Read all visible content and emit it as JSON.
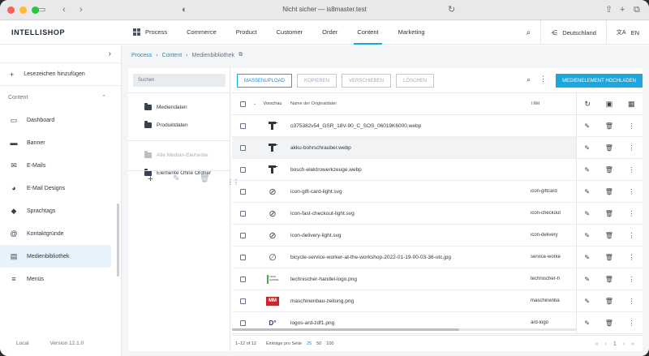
{
  "browser": {
    "url_text": "Nicht sicher — is8master.test"
  },
  "header": {
    "logo": "INTELLISHOP",
    "nav": [
      "Process",
      "Commerce",
      "Product",
      "Customer",
      "Order",
      "Content",
      "Marketing"
    ],
    "active_nav": "Content",
    "country": "Deutschland",
    "language": "EN",
    "accent": "#1aa6de"
  },
  "sidebar": {
    "bookmark": "Lesezeichen hinzufügen",
    "section": "Content",
    "items": [
      {
        "label": "Dashboard",
        "icon": "monitor-icon"
      },
      {
        "label": "Banner",
        "icon": "banner-icon"
      },
      {
        "label": "E-Mails",
        "icon": "mail-icon"
      },
      {
        "label": "E-Mail Designs",
        "icon": "palette-icon"
      },
      {
        "label": "Sprachtags",
        "icon": "tag-icon"
      },
      {
        "label": "Kontaktgründe",
        "icon": "at-icon"
      },
      {
        "label": "Medienbibliothek",
        "icon": "media-icon"
      },
      {
        "label": "Menüs",
        "icon": "menu-icon"
      }
    ],
    "active_item": "Medienbibliothek",
    "footer_env": "Local",
    "footer_version": "Version 12.1.0"
  },
  "breadcrumb": {
    "items": [
      "Process",
      "Content",
      "Medienbibliothek"
    ]
  },
  "folders": {
    "search_placeholder": "Suchen",
    "items": [
      "Mediendaten",
      "Produktdaten"
    ],
    "special": [
      "Alle Median-Elemente",
      "Elemente Ohne Ordner"
    ]
  },
  "toolbar": {
    "mass_upload": "MASSENUPLOAD",
    "copy": "KOPIEREN",
    "move": "VERSCHIEBEN",
    "delete": "LÖSCHEN",
    "upload": "MEDIENELEMENT HOCHLADEN"
  },
  "table": {
    "columns": {
      "preview": "Vorschau",
      "name": "Name der Originaldatei",
      "title": "Titel"
    },
    "rows": [
      {
        "name": "o375382v54_GSR_18V-90_C_SOS_06019K6000.webp",
        "title": "",
        "thumb": "drill"
      },
      {
        "name": "akku-bohrschrauber.webp",
        "title": "",
        "thumb": "drill"
      },
      {
        "name": "bosch-elektrowerkzeuge.webp",
        "title": "",
        "thumb": "drill"
      },
      {
        "name": "icon-gift-card-light.svg",
        "title": "icon-giftcard",
        "thumb": "no-image"
      },
      {
        "name": "icon-fast-checkout-light.svg",
        "title": "icon-checkout",
        "thumb": "no-image"
      },
      {
        "name": "icon-delivery-light.svg",
        "title": "icon-delivery",
        "thumb": "no-image"
      },
      {
        "name": "bicycle-service-worker-at-the-workshop-2022-01-19-00-03-36-utc.jpg",
        "title": "service-worke",
        "thumb": "empty"
      },
      {
        "name": "technischer-handel-logo.png",
        "title": "technischer-h",
        "thumb": "tech"
      },
      {
        "name": "maschinenbau-zeitung.png",
        "title": "maschinenba",
        "thumb": "mm"
      },
      {
        "name": "logos-ard-zdf1.png",
        "title": "ard-logo",
        "thumb": "ard"
      }
    ],
    "hover_row": 1
  },
  "footer": {
    "range": "1–12 of 12",
    "per_page_label": "Einträge pro Seite",
    "per_page_options": [
      "25",
      "50",
      "100"
    ],
    "per_page_active": "25",
    "current_page": "1"
  }
}
